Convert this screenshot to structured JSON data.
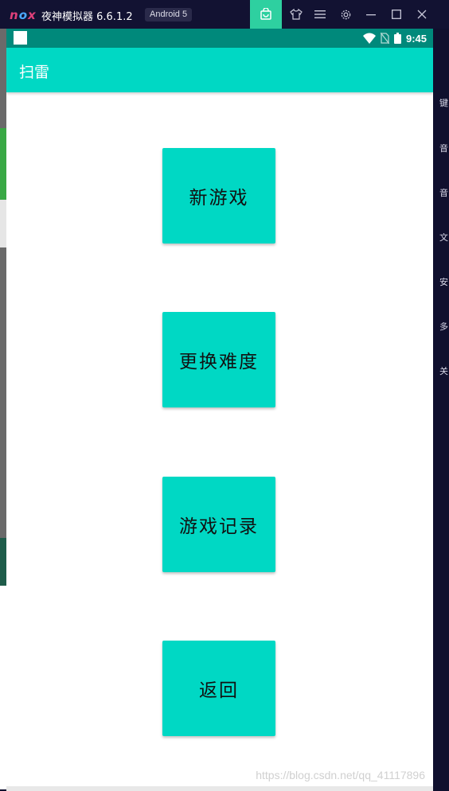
{
  "emulator": {
    "logo": "nox",
    "title": "夜神模拟器 6.6.1.2",
    "android_badge": "Android 5",
    "controls": [
      "app-store-icon",
      "skin-icon",
      "menu-icon",
      "settings-icon",
      "minimize-icon",
      "maximize-icon",
      "close-icon"
    ],
    "side_toolbar": [
      "键",
      "音",
      "音",
      "文",
      "安",
      "多",
      "关"
    ]
  },
  "status_bar": {
    "time": "9:45",
    "icons": [
      "wifi-icon",
      "no-sim-icon",
      "battery-icon"
    ]
  },
  "app_bar": {
    "title": "扫雷"
  },
  "menu": {
    "new_game": "新游戏",
    "change_difficulty": "更换难度",
    "game_records": "游戏记录",
    "back": "返回"
  },
  "watermark": "https://blog.csdn.net/qq_41117896",
  "colors": {
    "accent": "#00d8c4",
    "status_bar": "#00897b",
    "emulator_frame": "#10102e",
    "store_button": "#2ed0a0"
  }
}
